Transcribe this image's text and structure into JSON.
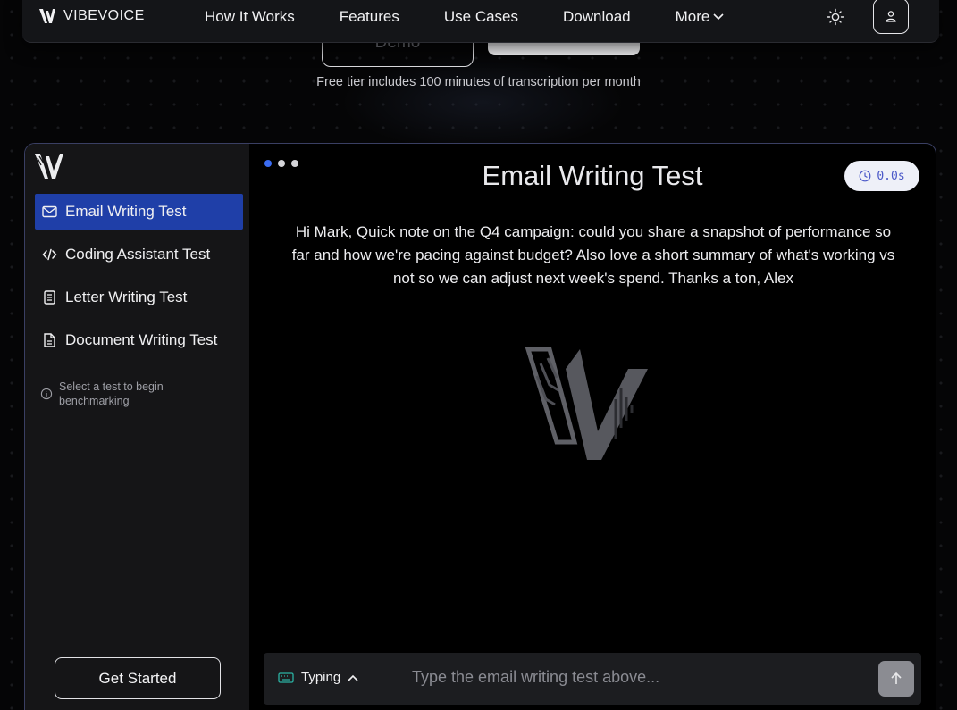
{
  "hero": {
    "demo_label": "Demo",
    "free_tier": "Free tier includes 100 minutes of transcription per month"
  },
  "navbar": {
    "brand": "VIBEVOICE",
    "links": [
      "How It Works",
      "Features",
      "Use Cases",
      "Download",
      "More"
    ]
  },
  "sidebar": {
    "items": [
      {
        "label": "Email Writing Test",
        "icon": "mail-icon",
        "active": true
      },
      {
        "label": "Coding Assistant Test",
        "icon": "code-icon",
        "active": false
      },
      {
        "label": "Letter Writing Test",
        "icon": "document-icon",
        "active": false
      },
      {
        "label": "Document Writing Test",
        "icon": "file-text-icon",
        "active": false
      }
    ],
    "hint": "Select a test to begin benchmarking",
    "get_started": "Get Started"
  },
  "main": {
    "title": "Email Writing Test",
    "timer": "0.0s",
    "passage": "Hi Mark, Quick note on the Q4 campaign: could you share a snapshot of performance so far and how we're pacing against budget? Also love a short summary of what's working vs not so we can adjust next week's spend. Thanks a ton, Alex",
    "mode_label": "Typing",
    "input_placeholder": "Type the email writing test above..."
  },
  "colors": {
    "accent": "#1f3fa8",
    "frame_border": "#3a3f63",
    "timer_text": "#4a58c8"
  }
}
